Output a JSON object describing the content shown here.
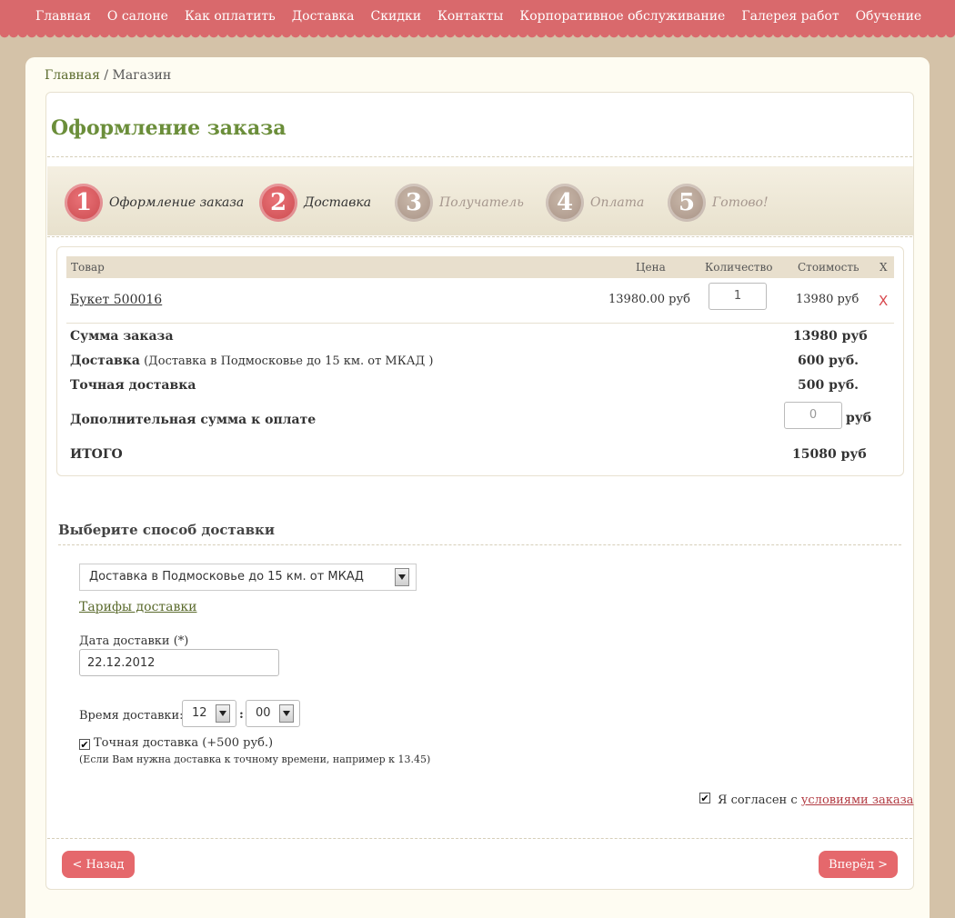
{
  "nav": {
    "items": [
      "Главная",
      "О салоне",
      "Как оплатить",
      "Доставка",
      "Скидки",
      "Контакты",
      "Корпоративное обслуживание",
      "Галерея работ",
      "Обучение"
    ]
  },
  "breadcrumb": {
    "home": "Главная",
    "separator": " / ",
    "current": "Магазин"
  },
  "page": {
    "title": "Оформление заказа"
  },
  "steps": [
    {
      "number": "1",
      "label": "Оформление заказа",
      "state": "active"
    },
    {
      "number": "2",
      "label": "Доставка",
      "state": "active"
    },
    {
      "number": "3",
      "label": "Получатель",
      "state": "inactive"
    },
    {
      "number": "4",
      "label": "Оплата",
      "state": "inactive"
    },
    {
      "number": "5",
      "label": "Готово!",
      "state": "inactive"
    }
  ],
  "cart": {
    "headers": {
      "product": "Товар",
      "price": "Цена",
      "quantity": "Количество",
      "cost": "Стоимость",
      "remove": "X"
    },
    "items": [
      {
        "name": "Букет 500016",
        "price": "13980.00 руб",
        "quantity": "1",
        "cost": "13980 руб",
        "remove": "X"
      }
    ],
    "summary": {
      "order_sum_label": "Сумма заказа",
      "order_sum_value": "13980 руб",
      "delivery_label": "Доставка",
      "delivery_note": " (Доставка в Подмосковье до 15 км. от МКАД )",
      "delivery_value": "600 руб.",
      "exact_label": "Точная доставка",
      "exact_value": "500 руб.",
      "extra_label": "Дополнительная сумма к оплате",
      "extra_value": "0",
      "extra_unit": "руб",
      "total_label": "ИТОГО",
      "total_value": "15080 руб"
    }
  },
  "delivery": {
    "section_title": "Выберите способ доставки",
    "method_selected": "Доставка в Подмосковье до 15 км. от МКАД",
    "tariffs_link": "Тарифы доставки",
    "date_label": "Дата доставки (*)",
    "date_value": "22.12.2012",
    "time_label": "Время доставки:",
    "hour_value": "12",
    "time_separator": ":",
    "minute_value": "00",
    "exact_checkbox_label": "Точная доставка (+500 руб.)",
    "exact_checked": true,
    "exact_hint": "(Если Вам нужна доставка к точному времени, например к 13.45)"
  },
  "agreement": {
    "prefix": "Я согласен с ",
    "link": "условиями заказа",
    "checked": true
  },
  "buttons": {
    "back": "< Назад",
    "next": "Вперёд >"
  },
  "colors": {
    "accent": "#d9696c",
    "title_green": "#6b8e3a",
    "background": "#d4c2a8"
  }
}
